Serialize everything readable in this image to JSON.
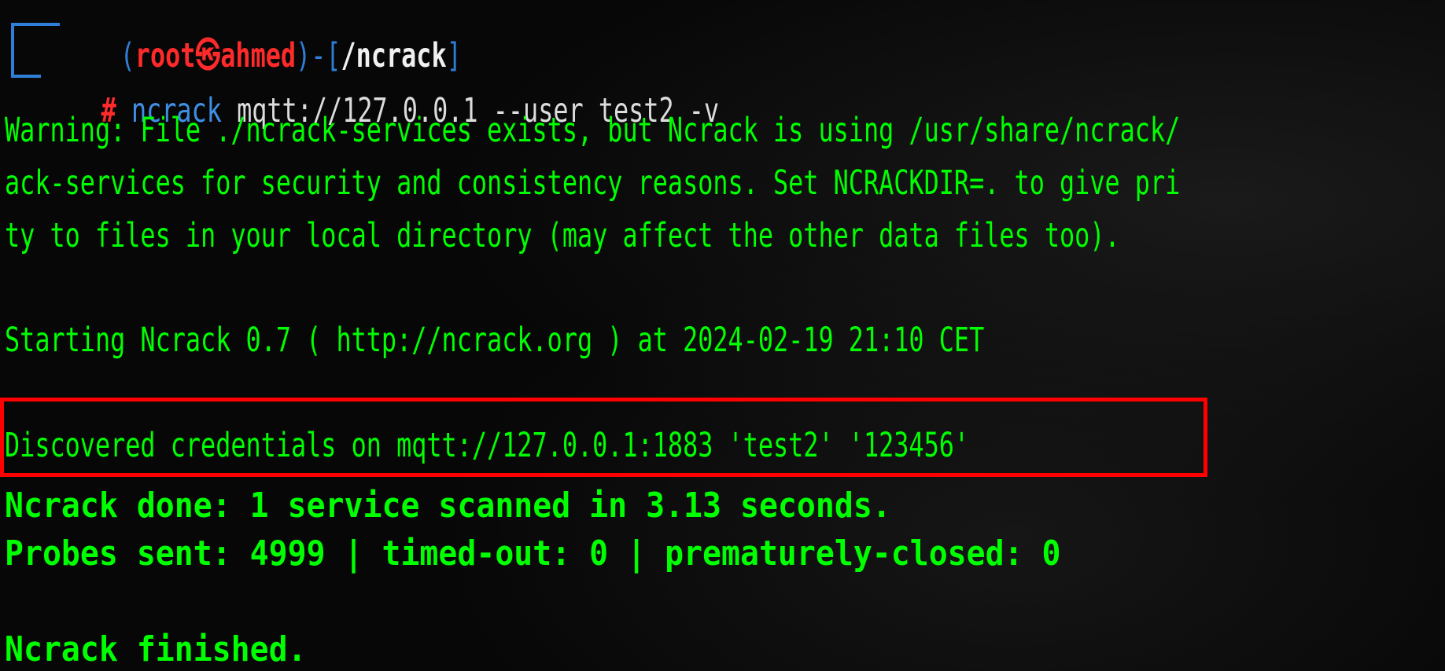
{
  "prompt": {
    "open_paren": "(",
    "user": "root",
    "at_symbol": "㉿",
    "host": "ahmed",
    "close_paren": ")",
    "dash": "-",
    "dir_open": "[",
    "dir": "/ncrack",
    "dir_close": "]",
    "hash": "#",
    "command": "ncrack",
    "args": "mqtt://127.0.0.1 --user test2 -v"
  },
  "output": {
    "warning_lines": [
      "Warning: File ./ncrack-services exists, but Ncrack is using /usr/share/ncrack/",
      "ack-services for security and consistency reasons. Set NCRACKDIR=. to give pri",
      "ty to files in your local directory (may affect the other data files too)."
    ],
    "starting": "Starting Ncrack 0.7 ( http://ncrack.org ) at 2024-02-19 21:10 CET",
    "credentials": "Discovered credentials on mqtt://127.0.0.1:1883 'test2' '123456'",
    "done": "Ncrack done: 1 service scanned in 3.13 seconds.",
    "probes": "Probes sent: 4999 | timed-out: 0 | prematurely-closed: 0",
    "finished": "Ncrack finished."
  },
  "colors": {
    "background": "#070707",
    "green": "#00ff00",
    "blue_frame": "#2f7fd8",
    "user_red": "#ff2a2a",
    "command_blue": "#3f8fe6",
    "args_white": "#dcdcdc",
    "highlight": "#ff0000"
  }
}
